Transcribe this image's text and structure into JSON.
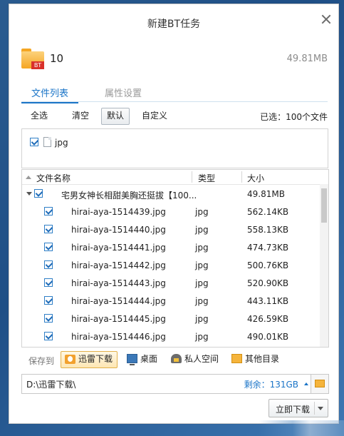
{
  "window": {
    "title": "新建BT任务"
  },
  "task": {
    "name": "10",
    "size": "49.81MB",
    "badge": "BT"
  },
  "tabs": [
    {
      "label": "文件列表",
      "active": true
    },
    {
      "label": "属性设置",
      "active": false
    }
  ],
  "toolbar": {
    "buttons": [
      "全选",
      "清空",
      "默认",
      "自定义"
    ],
    "selected": "默认",
    "selection_info": "已选：100个文件"
  },
  "filter": {
    "types": [
      {
        "label": "jpg",
        "checked": true
      }
    ]
  },
  "tree": {
    "columns": {
      "name": "文件名称",
      "type": "类型",
      "size": "大小"
    },
    "folder": {
      "name": "宅男女神长相甜美胸还挺拔【100...",
      "size": "49.81MB",
      "checked": true,
      "expanded": true
    },
    "files": [
      {
        "name": "hirai-aya-1514439.jpg",
        "type": "jpg",
        "size": "562.14KB",
        "checked": true
      },
      {
        "name": "hirai-aya-1514440.jpg",
        "type": "jpg",
        "size": "558.13KB",
        "checked": true
      },
      {
        "name": "hirai-aya-1514441.jpg",
        "type": "jpg",
        "size": "474.73KB",
        "checked": true
      },
      {
        "name": "hirai-aya-1514442.jpg",
        "type": "jpg",
        "size": "500.76KB",
        "checked": true
      },
      {
        "name": "hirai-aya-1514443.jpg",
        "type": "jpg",
        "size": "520.90KB",
        "checked": true
      },
      {
        "name": "hirai-aya-1514444.jpg",
        "type": "jpg",
        "size": "443.11KB",
        "checked": true
      },
      {
        "name": "hirai-aya-1514445.jpg",
        "type": "jpg",
        "size": "426.59KB",
        "checked": true
      },
      {
        "name": "hirai-aya-1514446.jpg",
        "type": "jpg",
        "size": "490.01KB",
        "checked": true
      }
    ]
  },
  "save_to": {
    "label": "保存到",
    "options": [
      {
        "label": "迅雷下载",
        "icon": "thunder-folder-icon",
        "selected": true
      },
      {
        "label": "桌面",
        "icon": "desktop-icon",
        "selected": false
      },
      {
        "label": "私人空间",
        "icon": "private-space-icon",
        "selected": false
      },
      {
        "label": "其他目录",
        "icon": "folder-icon",
        "selected": false
      }
    ]
  },
  "path": {
    "value": "D:\\迅雷下载\\",
    "free_space": "剩余：131GB"
  },
  "actions": {
    "download_now": "立即下载"
  },
  "colors": {
    "accent": "#1a74c7",
    "checkbox": "#2f7fc7",
    "selected_option_bg": "#fde6b3"
  }
}
